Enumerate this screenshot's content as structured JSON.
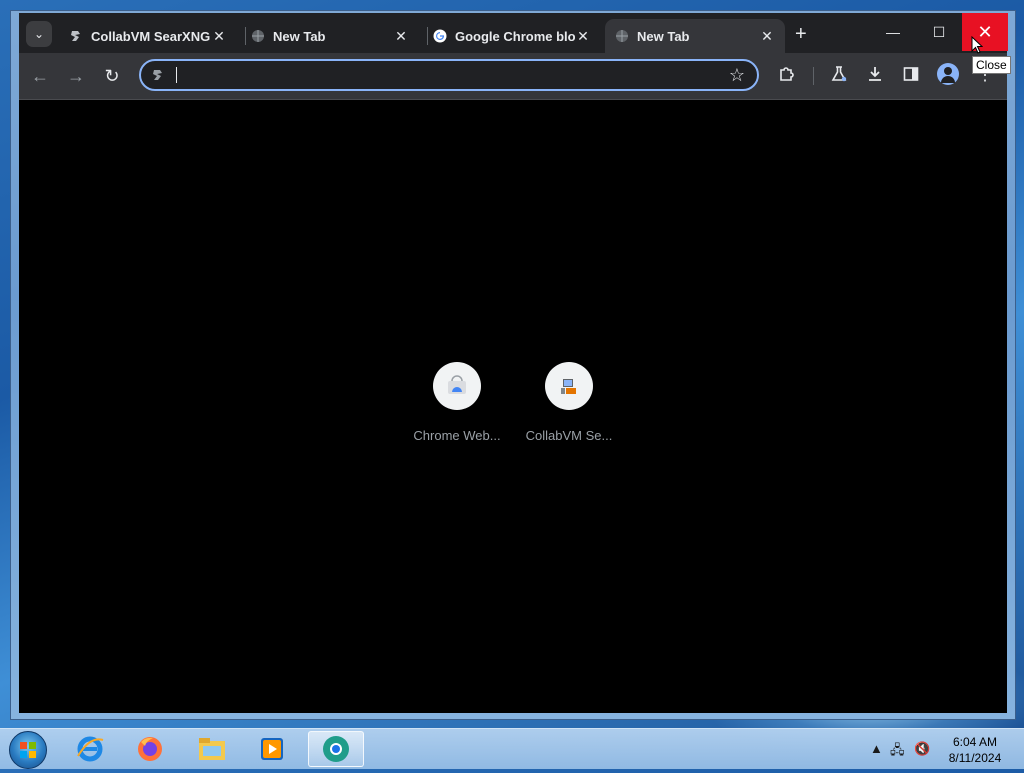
{
  "tabs": [
    {
      "title": "CollabVM SearXNG",
      "favicon": "searxng-icon",
      "active": false
    },
    {
      "title": "New Tab",
      "favicon": "globe-icon",
      "active": false
    },
    {
      "title": "Google Chrome blo",
      "favicon": "google-icon",
      "active": false
    },
    {
      "title": "New Tab",
      "favicon": "globe-icon",
      "active": true
    }
  ],
  "tab_close_glyph": "✕",
  "new_tab_glyph": "+",
  "window_buttons": {
    "minimize": "—",
    "maximize": "☐",
    "close": "✕"
  },
  "tooltip": "Close",
  "omnibox": {
    "value": "",
    "placeholder": ""
  },
  "shortcuts": [
    {
      "label": "Chrome Web...",
      "icon": "chrome-web-store-icon"
    },
    {
      "label": "CollabVM Se...",
      "icon": "collabvm-icon"
    }
  ],
  "taskbar": {
    "apps": [
      "internet-explorer-icon",
      "firefox-icon",
      "file-explorer-icon",
      "media-player-icon",
      "chrome-icon"
    ],
    "time": "6:04 AM",
    "date": "8/11/2024"
  },
  "colors": {
    "accent": "#8ab4f8",
    "close_red": "#e81123",
    "tab_bg": "#202124",
    "toolbar_bg": "#35363a"
  }
}
